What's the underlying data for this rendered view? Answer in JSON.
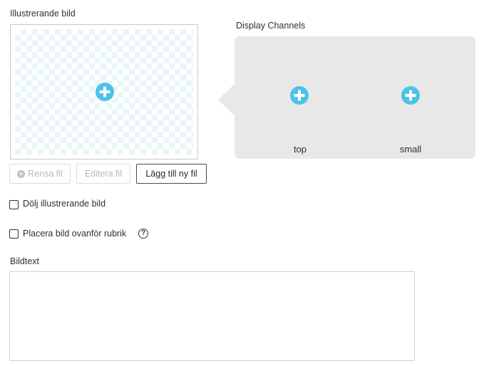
{
  "image_section": {
    "label": "Illustrerande bild",
    "add_icon": "plus-circle-icon"
  },
  "channels": {
    "label": "Display Channels",
    "items": [
      {
        "label": "top",
        "icon": "plus-circle-icon"
      },
      {
        "label": "small",
        "icon": "plus-circle-icon"
      }
    ]
  },
  "buttons": {
    "clear_label": "Rensa fil",
    "edit_label": "Editera fil",
    "add_label": "Lägg till ny fil"
  },
  "options": {
    "hide_image_label": "Dölj illustrerande bild",
    "hide_image_checked": false,
    "place_above_label": "Placera bild ovanför rubrik",
    "place_above_checked": false,
    "help_icon": "question-circle-icon",
    "help_glyph": "?"
  },
  "caption": {
    "label": "Bildtext",
    "value": ""
  },
  "colors": {
    "accent": "#4cc3e6",
    "panel_bg": "#e8e8e8",
    "checker": "#e9f6f8"
  }
}
